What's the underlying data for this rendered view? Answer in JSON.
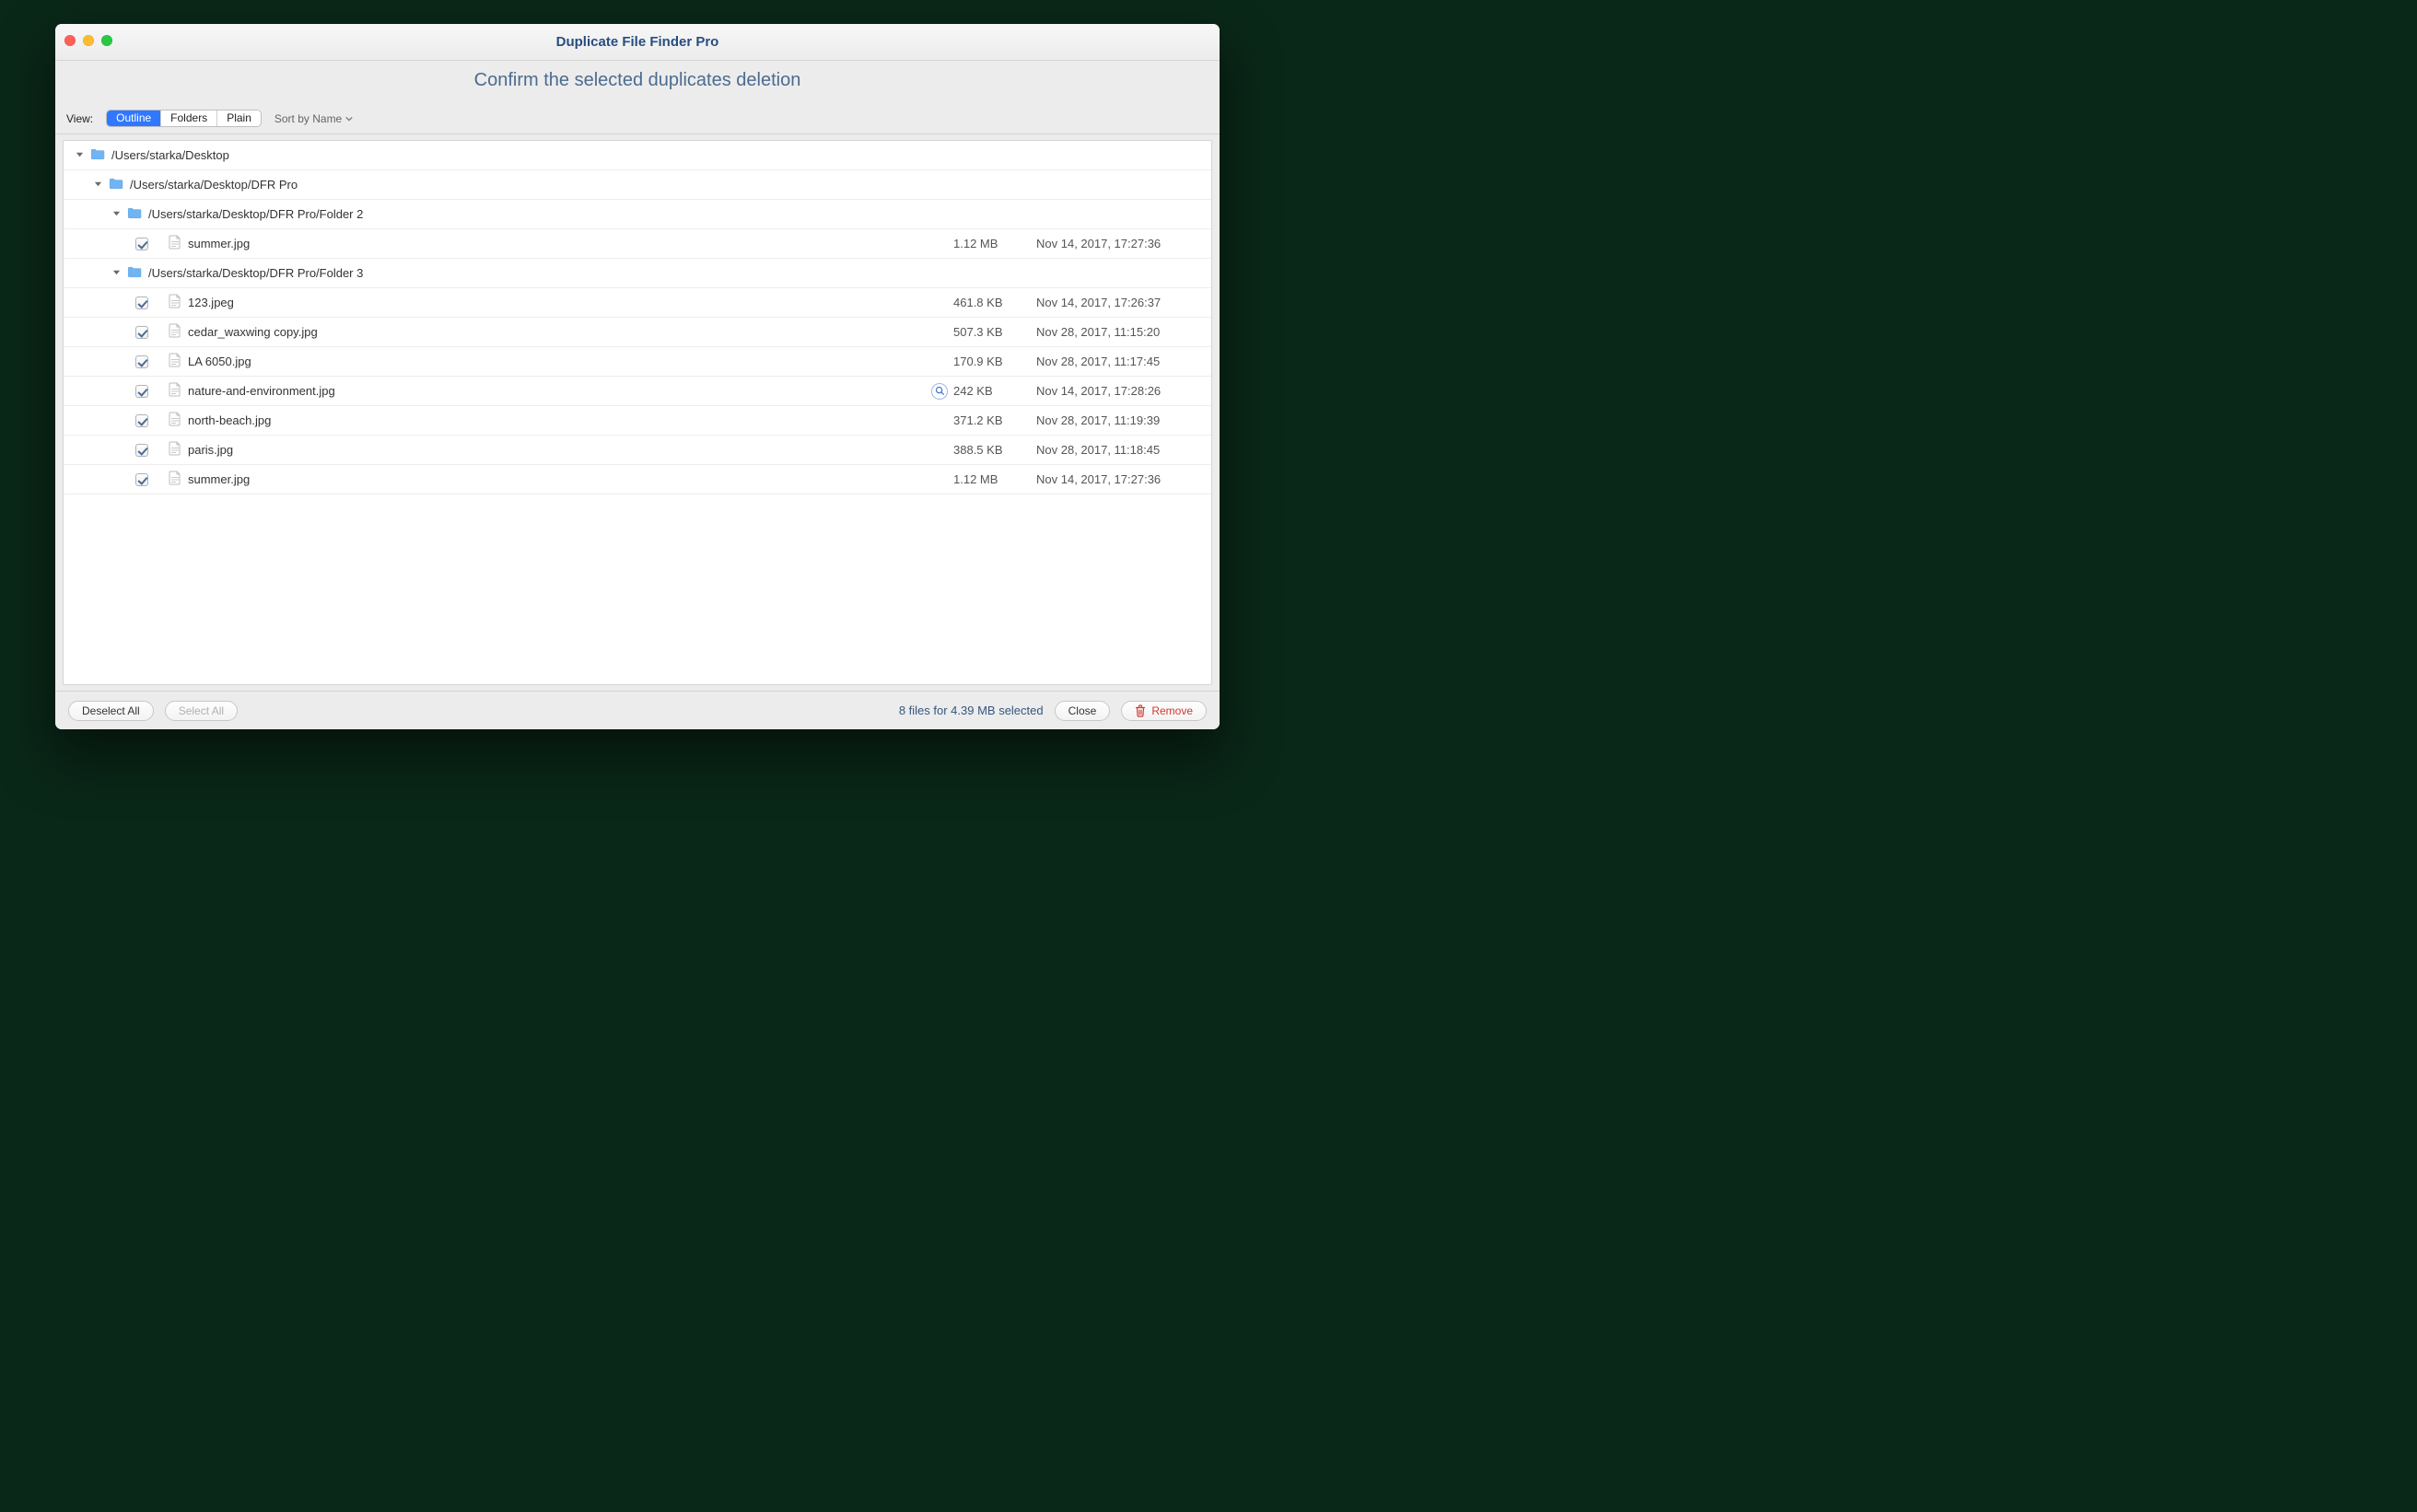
{
  "window": {
    "title": "Duplicate File Finder Pro",
    "subtitle": "Confirm the selected duplicates deletion"
  },
  "toolbar": {
    "view_label": "View:",
    "tabs": {
      "outline": "Outline",
      "folders": "Folders",
      "plain": "Plain"
    },
    "sort_label": "Sort by Name"
  },
  "tree": {
    "root": {
      "path": "/Users/starka/Desktop",
      "children": [
        {
          "path": "/Users/starka/Desktop/DFR Pro",
          "children": [
            {
              "path": "/Users/starka/Desktop/DFR Pro/Folder 2",
              "files": [
                {
                  "name": "summer.jpg",
                  "size": "1.12 MB",
                  "date": "Nov 14, 2017, 17:27:36",
                  "checked": true,
                  "preview": false
                }
              ]
            },
            {
              "path": "/Users/starka/Desktop/DFR Pro/Folder 3",
              "files": [
                {
                  "name": "123.jpeg",
                  "size": "461.8 KB",
                  "date": "Nov 14, 2017, 17:26:37",
                  "checked": true,
                  "preview": false
                },
                {
                  "name": "cedar_waxwing copy.jpg",
                  "size": "507.3 KB",
                  "date": "Nov 28, 2017, 11:15:20",
                  "checked": true,
                  "preview": false
                },
                {
                  "name": "LA 6050.jpg",
                  "size": "170.9 KB",
                  "date": "Nov 28, 2017, 11:17:45",
                  "checked": true,
                  "preview": false
                },
                {
                  "name": "nature-and-environment.jpg",
                  "size": "242 KB",
                  "date": "Nov 14, 2017, 17:28:26",
                  "checked": true,
                  "preview": true
                },
                {
                  "name": "north-beach.jpg",
                  "size": "371.2 KB",
                  "date": "Nov 28, 2017, 11:19:39",
                  "checked": true,
                  "preview": false
                },
                {
                  "name": "paris.jpg",
                  "size": "388.5 KB",
                  "date": "Nov 28, 2017, 11:18:45",
                  "checked": true,
                  "preview": false
                },
                {
                  "name": "summer.jpg",
                  "size": "1.12 MB",
                  "date": "Nov 14, 2017, 17:27:36",
                  "checked": true,
                  "preview": false
                }
              ]
            }
          ]
        }
      ]
    }
  },
  "footer": {
    "deselect_label": "Deselect All",
    "select_label": "Select All",
    "status": "8 files for 4.39 MB selected",
    "close_label": "Close",
    "remove_label": "Remove"
  },
  "icons": {
    "folder_color": "#6fb4f3",
    "accent": "#2f78ff",
    "danger": "#cf3a32"
  }
}
